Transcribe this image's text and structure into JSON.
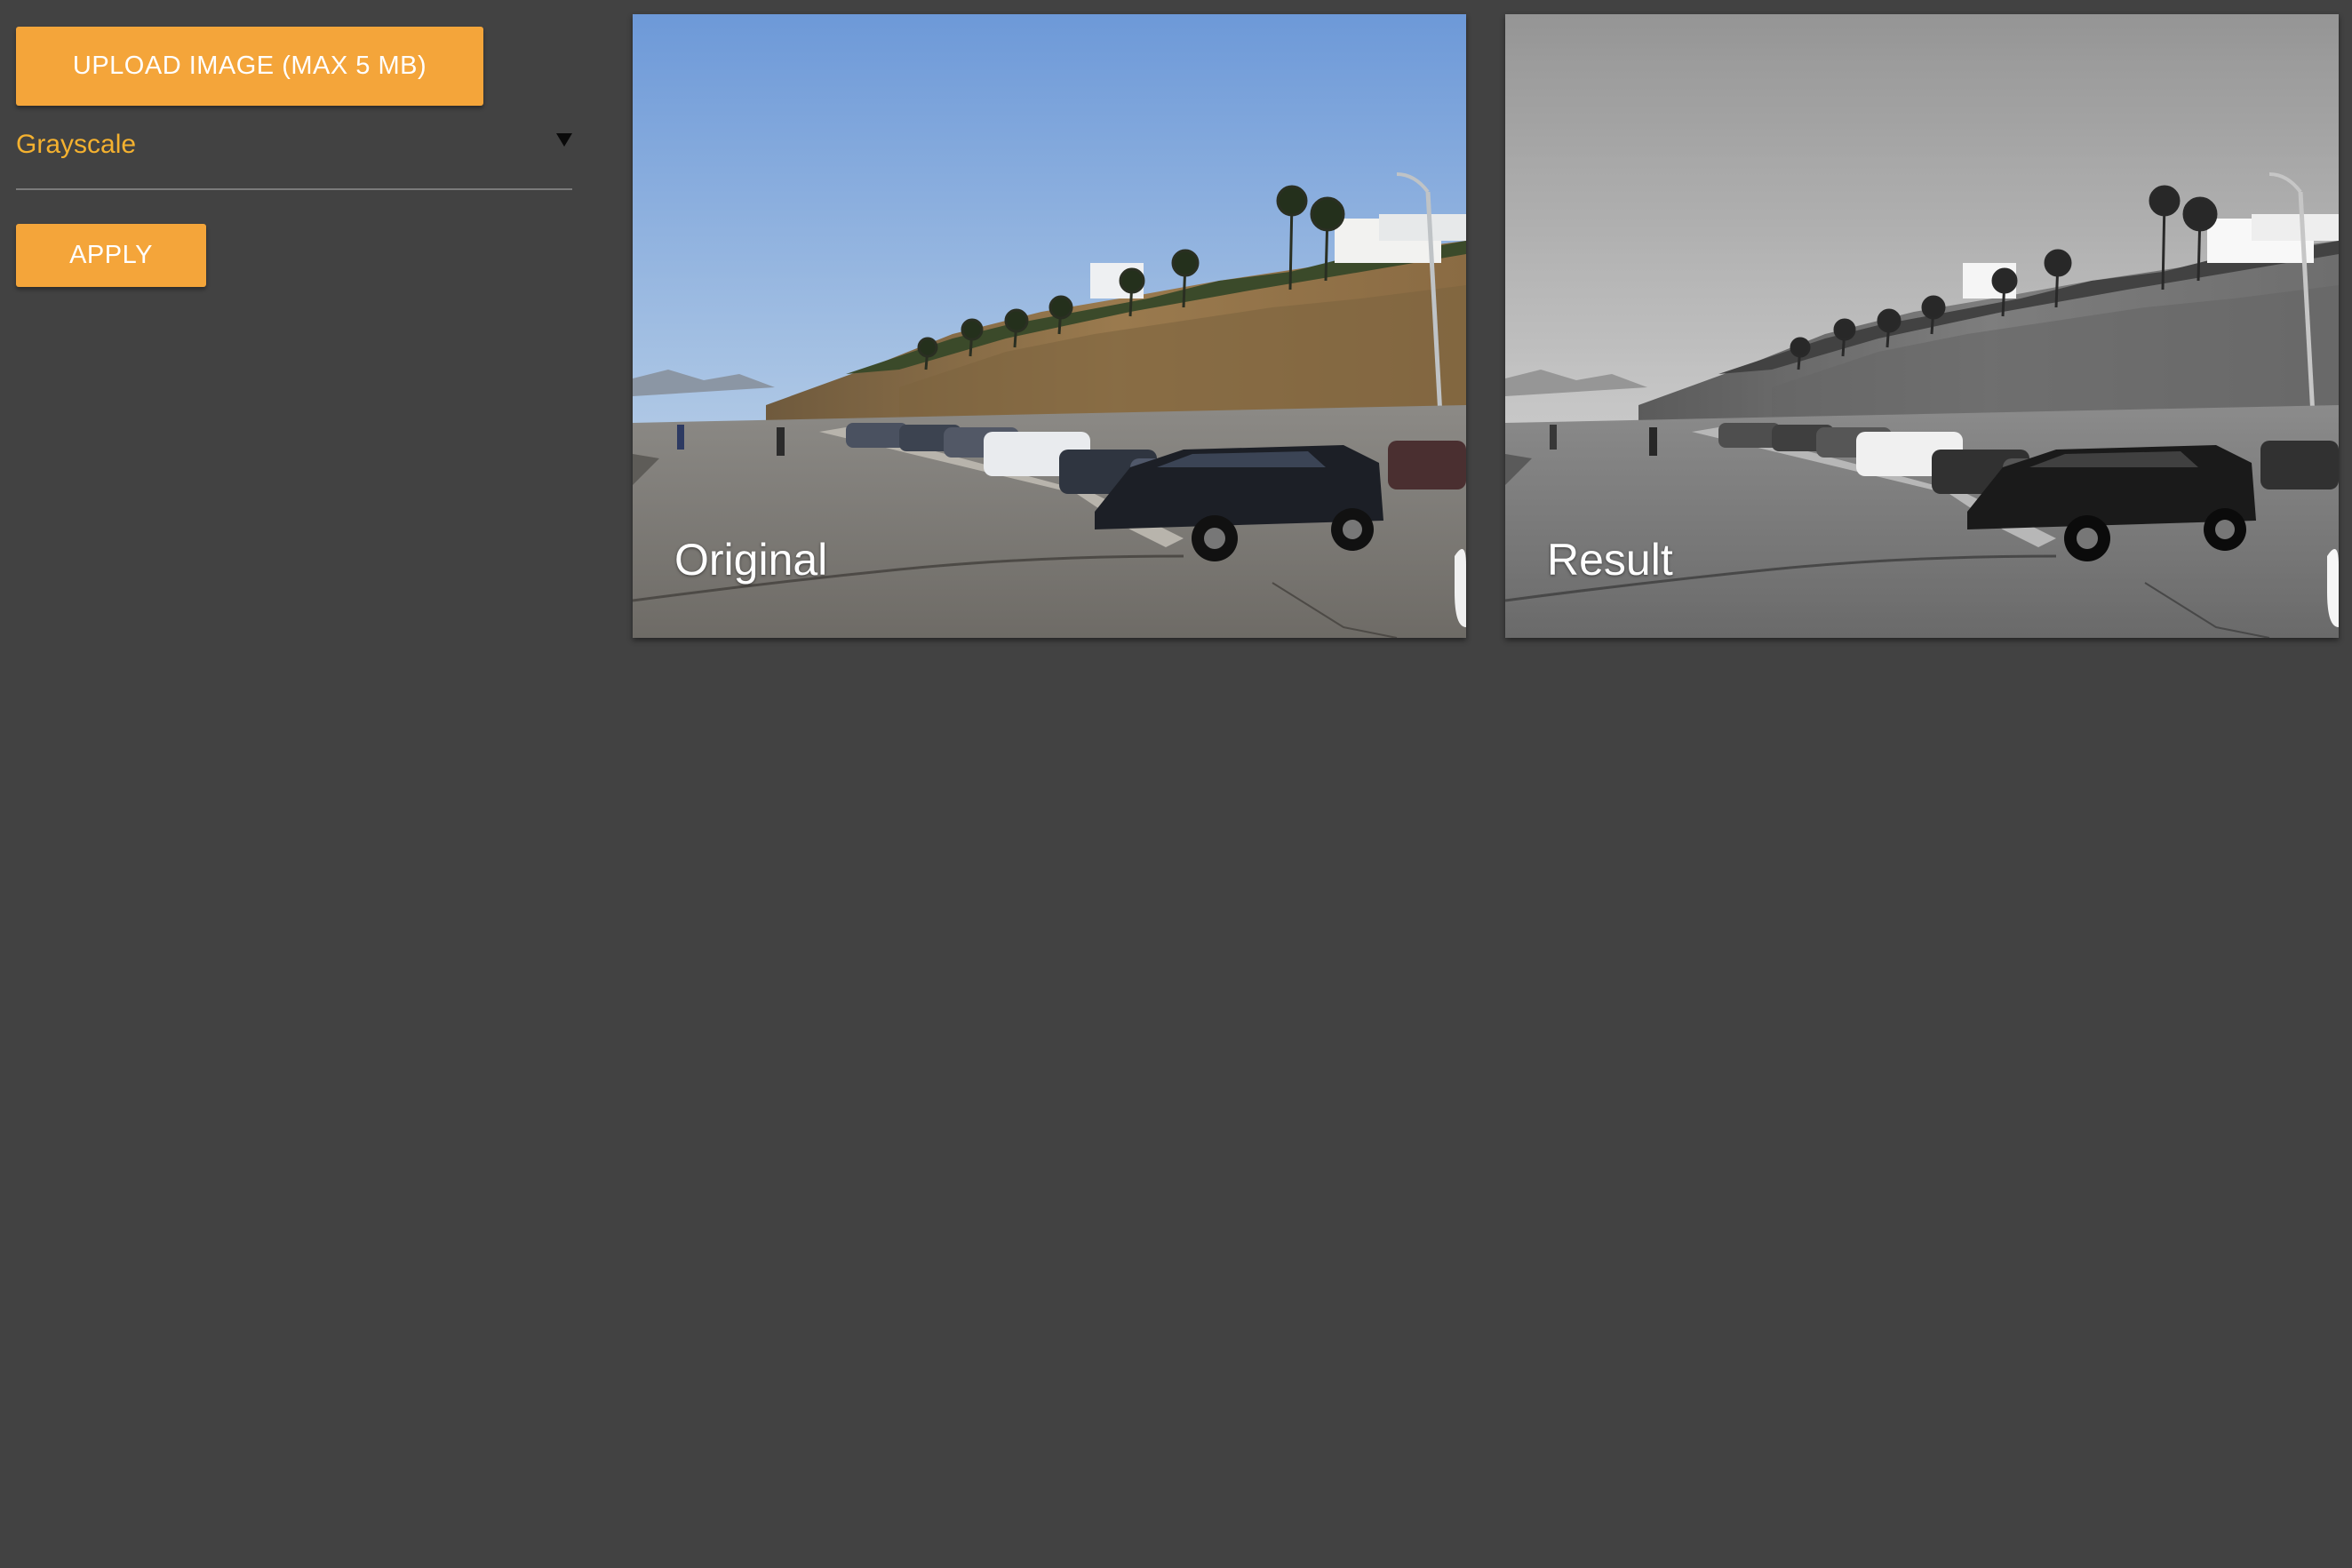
{
  "controls": {
    "upload_label": "UPLOAD IMAGE (MAX 5 MB)",
    "filter_select": {
      "selected": "Grayscale"
    },
    "apply_label": "APPLY"
  },
  "images": {
    "original_label": "Original",
    "result_label": "Result"
  },
  "icons": {
    "dropdown": "triangle-down-icon"
  },
  "colors": {
    "background": "#424242",
    "accent": "#f4a53a",
    "select_text": "#f4b12f"
  }
}
